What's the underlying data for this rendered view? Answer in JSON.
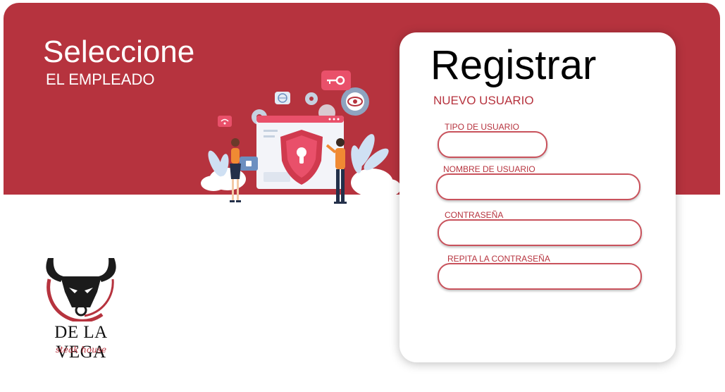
{
  "hero": {
    "title": "Seleccione",
    "subtitle": "EL EMPLEADO"
  },
  "register": {
    "title": "Registrar",
    "subtitle": "NUEVO USUARIO",
    "fields": [
      {
        "label": "TIPO DE USUARIO",
        "value": ""
      },
      {
        "label": "NOMBRE DE USUARIO",
        "value": ""
      },
      {
        "label": "CONTRASEÑA",
        "value": ""
      },
      {
        "label": "REPITA LA CONTRASEÑA",
        "value": ""
      }
    ]
  },
  "logo": {
    "name": "DE LA VEGA",
    "tagline": "steak house"
  },
  "colors": {
    "brand": "#b6333e",
    "accent_orange": "#f08a33",
    "light_blue": "#cfe0f3",
    "dark_navy": "#23304a"
  },
  "icons": [
    "security-shield-icon",
    "key-icon",
    "gear-icon",
    "eye-icon",
    "wifi-icon",
    "globe-icon",
    "lock-icon",
    "bull-logo-icon"
  ]
}
